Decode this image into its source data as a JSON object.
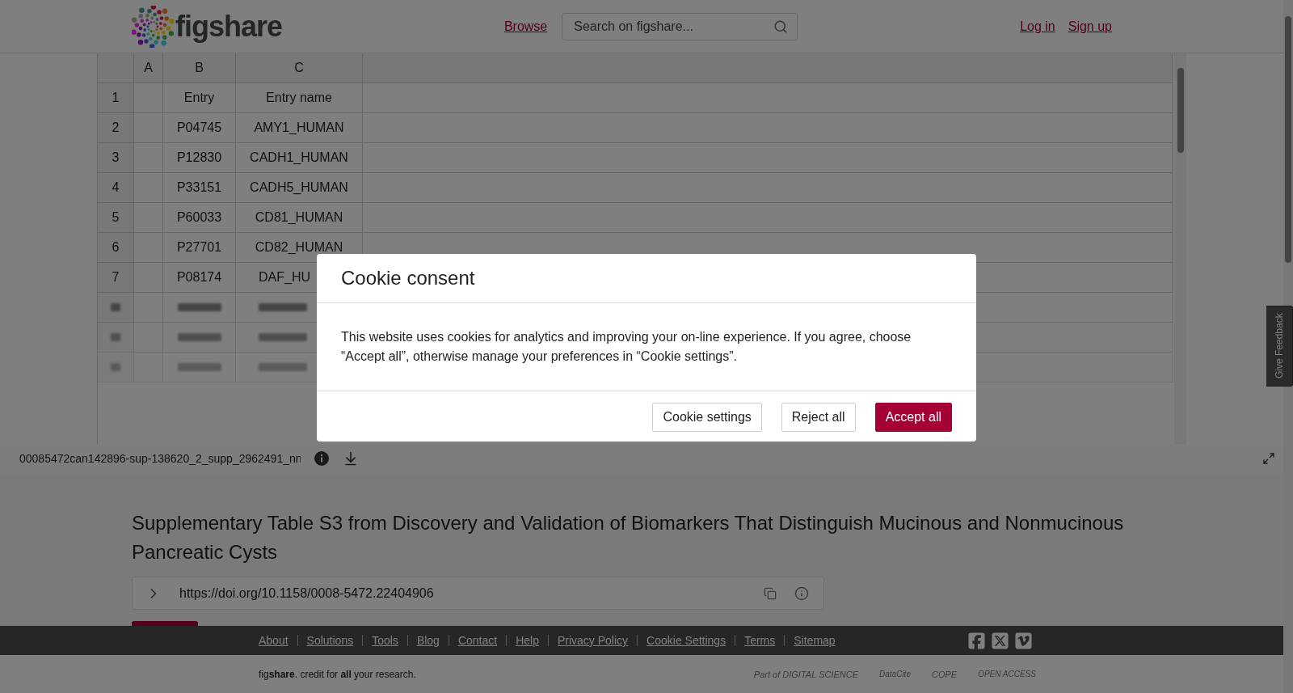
{
  "header": {
    "logo_text": "figshare",
    "nav_link": "Browse",
    "search": {
      "placeholder": "Search on figshare..."
    },
    "auth_links": [
      "Log in",
      "Sign up"
    ]
  },
  "spreadsheet": {
    "columns": [
      "A",
      "B",
      "C"
    ],
    "rows": [
      {
        "number": "1",
        "b": "Entry",
        "c": "Entry name",
        "kind": "normal",
        "cut": false
      },
      {
        "number": "2",
        "b": "P04745",
        "c": "AMY1_HUMAN",
        "kind": "normal",
        "cut": false
      },
      {
        "number": "3",
        "b": "P12830",
        "c": "CADH1_HUMAN",
        "kind": "normal",
        "cut": false
      },
      {
        "number": "4",
        "b": "P33151",
        "c": "CADH5_HUMAN",
        "kind": "normal",
        "cut": false
      },
      {
        "number": "5",
        "b": "P60033",
        "c": "CD81_HUMAN",
        "kind": "normal",
        "cut": false
      },
      {
        "number": "6",
        "b": "P27701",
        "c": "CD82_HUMAN",
        "kind": "normal",
        "cut": false
      },
      {
        "number": "7",
        "b": "P08174",
        "c": "DAF_HU",
        "kind": "normal",
        "cut": true
      },
      {
        "kind": "blurred"
      },
      {
        "kind": "blurred"
      },
      {
        "kind": "blurred"
      }
    ]
  },
  "viewer": {
    "filename": "00085472can142896-sup-138620_2_supp_2962491_nn"
  },
  "article": {
    "title": "Supplementary Table S3 from Discovery and Validation of Biomarkers That Distinguish Mucinous and Nonmucinous Pancreatic Cysts",
    "doi": "https://doi.org/10.1158/0008-5472.22404906"
  },
  "footer": {
    "links": [
      "About",
      "Solutions",
      "Tools",
      "Blog",
      "Contact",
      "Help",
      "Privacy Policy",
      "Cookie Settings",
      "Terms",
      "Sitemap"
    ],
    "tagline": "fig**share**. credit for **all** your research.",
    "partners": [
      {
        "label": "Part of DIGITAL SCIENCE",
        "kind": "wide"
      },
      {
        "label": "DataCite",
        "kind": "small"
      },
      {
        "label": "COPE",
        "kind": "wide"
      },
      {
        "label": "OPEN ACCESS",
        "kind": "small"
      }
    ]
  },
  "feedback_tab": "Give Feedback",
  "cookie_dialog": {
    "title": "Cookie consent",
    "text": "This website uses cookies for analytics and improving your on-line experience. If you agree, choose “Accept all”, otherwise manage your preferences in “Cookie settings”.",
    "buttons": [
      {
        "label": "Cookie settings",
        "kind": "outline"
      },
      {
        "label": "Reject all",
        "kind": "outline"
      },
      {
        "label": "Accept all",
        "kind": "primary"
      }
    ]
  }
}
